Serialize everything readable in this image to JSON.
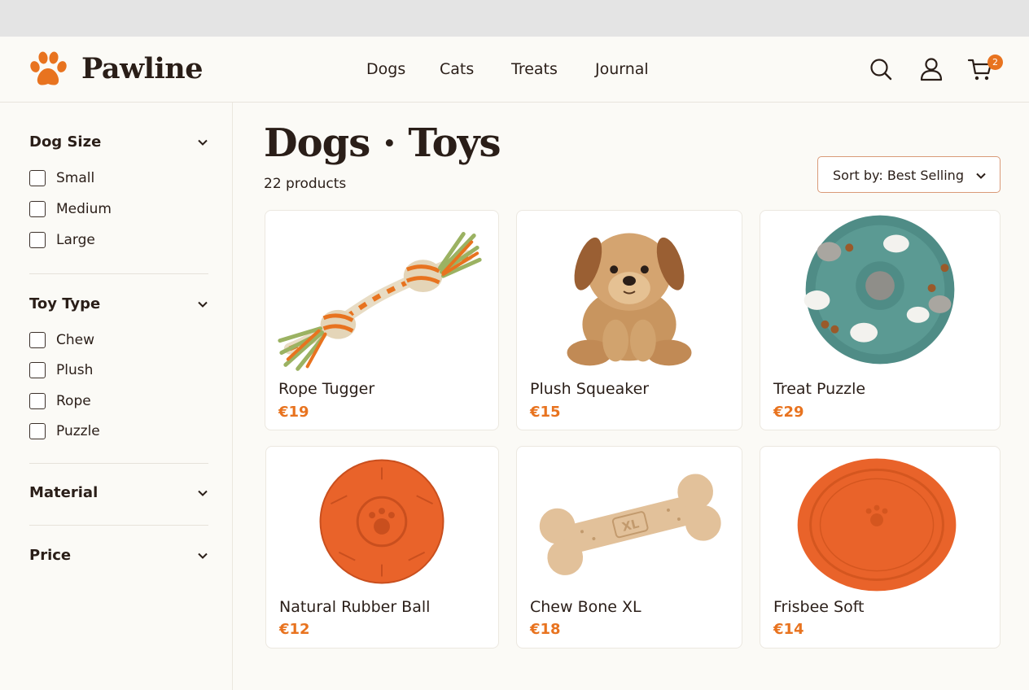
{
  "brand": {
    "name": "Pawline",
    "accent": "#e8731f",
    "text_color": "#2a1e18"
  },
  "nav": {
    "items": [
      "Dogs",
      "Cats",
      "Treats",
      "Journal"
    ]
  },
  "header_icons": {
    "search": "search-icon",
    "account": "user-icon",
    "cart": "cart-icon",
    "cart_count": "2"
  },
  "filters": [
    {
      "title": "Dog Size",
      "expanded": true,
      "options": [
        "Small",
        "Medium",
        "Large"
      ]
    },
    {
      "title": "Toy Type",
      "expanded": true,
      "options": [
        "Chew",
        "Plush",
        "Rope",
        "Puzzle"
      ]
    },
    {
      "title": "Material",
      "expanded": false,
      "options": []
    },
    {
      "title": "Price",
      "expanded": false,
      "options": []
    }
  ],
  "page": {
    "title": "Dogs · Toys",
    "count": "22 products"
  },
  "sort": {
    "label": "Sort by: Best Selling"
  },
  "products": [
    {
      "name": "Rope Tugger",
      "price": "€19",
      "image": "rope-toy"
    },
    {
      "name": "Plush Squeaker",
      "price": "€15",
      "image": "plush-puppy"
    },
    {
      "name": "Treat Puzzle",
      "price": "€29",
      "image": "treat-puzzle"
    },
    {
      "name": "Natural Rubber Ball",
      "price": "€12",
      "image": "rubber-ball"
    },
    {
      "name": "Chew Bone XL",
      "price": "€18",
      "image": "chew-bone",
      "image_text": "XL"
    },
    {
      "name": "Frisbee Soft",
      "price": "€14",
      "image": "frisbee"
    }
  ]
}
